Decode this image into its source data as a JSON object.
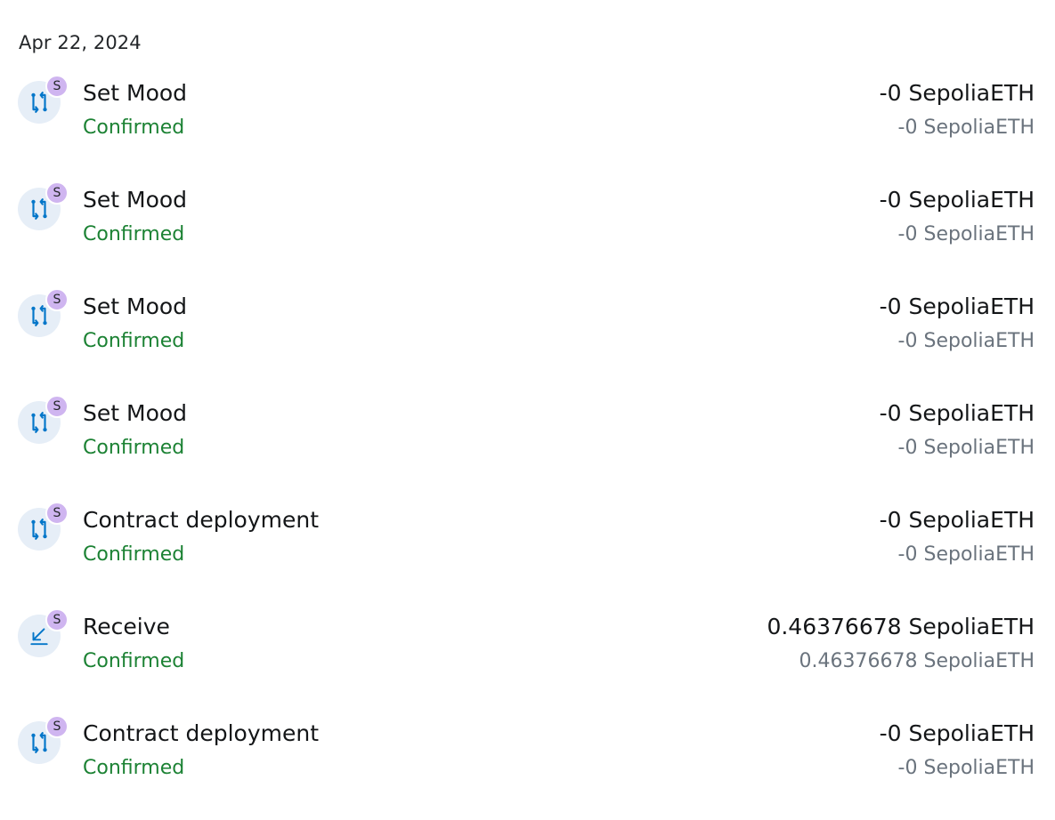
{
  "date_header": "Apr 22, 2024",
  "colors": {
    "status_confirmed": "#1c8234",
    "icon_background": "#e6eef7",
    "icon_accent": "#0376c9",
    "network_badge": "#cfb5f0"
  },
  "transactions": [
    {
      "icon": "contract-interaction-icon",
      "network_badge": "S",
      "title": "Set Mood",
      "status": "Confirmed",
      "amount": "-0 SepoliaETH",
      "secondary_amount": "-0 SepoliaETH"
    },
    {
      "icon": "contract-interaction-icon",
      "network_badge": "S",
      "title": "Set Mood",
      "status": "Confirmed",
      "amount": "-0 SepoliaETH",
      "secondary_amount": "-0 SepoliaETH"
    },
    {
      "icon": "contract-interaction-icon",
      "network_badge": "S",
      "title": "Set Mood",
      "status": "Confirmed",
      "amount": "-0 SepoliaETH",
      "secondary_amount": "-0 SepoliaETH"
    },
    {
      "icon": "contract-interaction-icon",
      "network_badge": "S",
      "title": "Set Mood",
      "status": "Confirmed",
      "amount": "-0 SepoliaETH",
      "secondary_amount": "-0 SepoliaETH"
    },
    {
      "icon": "contract-interaction-icon",
      "network_badge": "S",
      "title": "Contract deployment",
      "status": "Confirmed",
      "amount": "-0 SepoliaETH",
      "secondary_amount": "-0 SepoliaETH"
    },
    {
      "icon": "receive-arrow-icon",
      "network_badge": "S",
      "title": "Receive",
      "status": "Confirmed",
      "amount": "0.46376678 SepoliaETH",
      "secondary_amount": "0.46376678 SepoliaETH"
    },
    {
      "icon": "contract-interaction-icon",
      "network_badge": "S",
      "title": "Contract deployment",
      "status": "Confirmed",
      "amount": "-0 SepoliaETH",
      "secondary_amount": "-0 SepoliaETH"
    }
  ]
}
